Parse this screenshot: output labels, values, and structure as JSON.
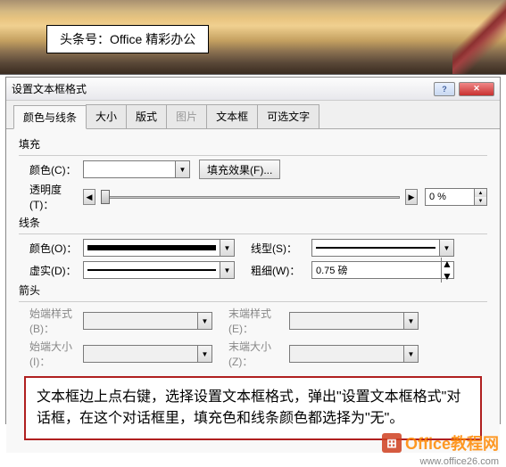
{
  "banner": {
    "text": "头条号：Office 精彩办公"
  },
  "dialog": {
    "title": "设置文本框格式",
    "tabs": [
      "颜色与线条",
      "大小",
      "版式",
      "图片",
      "文本框",
      "可选文字"
    ],
    "fill": {
      "section": "填充",
      "color_label": "颜色(C)：",
      "fill_effect_btn": "填充效果(F)...",
      "transparency_label": "透明度(T)：",
      "transparency_value": "0 %"
    },
    "line": {
      "section": "线条",
      "color_label": "颜色(O)：",
      "dash_label": "虚实(D)：",
      "style_label": "线型(S)：",
      "weight_label": "粗细(W)：",
      "weight_value": "0.75 磅"
    },
    "arrow": {
      "section": "箭头",
      "begin_style": "始端样式(B)：",
      "begin_size": "始端大小(I)：",
      "end_style": "末端样式(E)：",
      "end_size": "末端大小(Z)："
    },
    "note": "文本框边上点右键，选择设置文本框格式，弹出\"设置文本框格式\"对话框，在这个对话框里，填充色和线条颜色都选择为\"无\"。"
  },
  "watermark": {
    "brand": "Office教程网",
    "url": "www.office26.com"
  }
}
